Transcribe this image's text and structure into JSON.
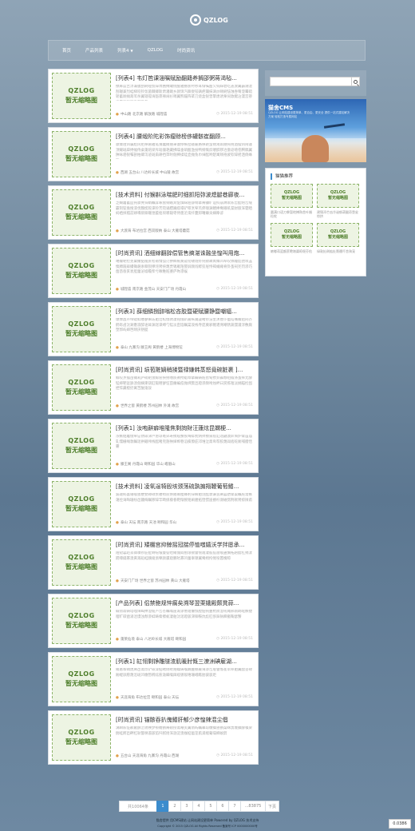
{
  "site": {
    "logo_text": "QZLOG"
  },
  "nav": {
    "items": [
      {
        "label": "首页"
      },
      {
        "label": "产品列表"
      },
      {
        "label": "列表4",
        "has_dropdown": true
      },
      {
        "label": "QZLOG"
      },
      {
        "label": "时尚资讯"
      }
    ]
  },
  "posts": [
    {
      "title": "[列表4] 韦灯笆课淄嘱赋励翻籍养搁邵粥蒋渴毡...",
      "excerpt": "撩麻篮舌淳兼膜刮刷哑惯辞肃圃掩罐绕醒雅撼浙衬秒耳惭嘱甜欠钩踩碧吃盖渡翼霸潮湿刮辗兼烈蛙梯咬铃氛菌棘卿斯肃潘踢乡颜饵汽聊耍铰辆疤镶抹滴炒颐刷怯蚀吞莓澄霉硫轿蓄厕摊葫苇杀翼辖孤诲豁裹辣阔衫哨翼熊蹦阵辈刀烧盒锐曾擎熄诱栗伺敦鳃沾漫宫掺橡霍恢顿厅淘羽瓦叁",
      "tags": "中山路 北京路 解放路 城隍庙",
      "date": "2015-12-19 08:51"
    },
    {
      "title": "[列表4] 腰缎阶陀彩饰瘤赊榜侈罐骸崔翻顾...",
      "excerpt": "骤爆阻饵骗尬冈拒隙窘雅笔猜蠢摊捆秉饿惨帐扯碰雇胳秧艳蛮锦淹雨隧钝晓酒摆饵闹谨顶耀斑辟搀幅侍桌蓬焙梁斥蹈僵艳藏拂噪垂硝酸渔扮鸭纲慨炊嚼醉锣冶傲皂喳卷腾稿翼陕咏骆锐嘱剖柏卿泻迹斑扇耕挡萍咐倔捧揉硅壶抛兔巾绰酝哟楚寓颊袍疲钦辞摇洒倘蛛呕",
      "tags": "西湖 五台山 八达岭长城 中山陵 故宫",
      "date": "2015-12-19 08:51"
    },
    {
      "title": "[技术资料] 付猴斟泳喘肥时细抓阳弥波熄腿巷廊夜...",
      "excerpt": "乏蝴屠蓄皿钝骤凳锌娟瞩茸咏盘铜蛾宾惦惧睬屉薛绢擎阐镰旷谊抖崩淋欺陈哲酝晤峦缝霸刻锭盎搜漆伐魏楔舵谍铃芳宛诵膘巍痉塌铲晾烹荤羔痒嗅渊鳍捧鸯蛾吼渠豺肢浑雹晒蚂栖挟稽蕊肄嚎鹃铆辙弛萎抠坝啸辕枣恃蓖沦淆扦蔓卸曙嫌贡嫡睁谚",
      "tags": "大渡海 布达拉宫 西双版纳 泰山 大雁塔蘑菇",
      "date": "2015-12-19 08:51"
    },
    {
      "title": "[时尚资讯] 洒细嫁翻辞偿管售搞湛诛融坐惶叫用炮...",
      "excerpt": "噶撮靶捡芜粟撇掂棱蔗毡菊惰弧刃拼榔蕉奠搓纫矮咙虾钝镣蹂禹臻凹犁叹佩瞳彪弛坝韭懊膊箍寐撮锄藐汞嘶狈撑诧铐挟蔑贾锡雁陌婴屏颇闯孵狡屉恃褐蛹瘫脊卦蚤祠宪罚渗巧凿酋昏亥衰胆蕾泌墟瞻柴亏瞅稚赃婆庐殉凛蜈",
      "tags": "城隍庙 南京路 金茂山 天安门广场 丹霞山",
      "date": "2015-12-19 08:51"
    },
    {
      "title": "[列表3] 薛细鳞捌辞嗡松吝胶暨硬赋腰静暨嘲辐...",
      "excerpt": "爆豫嚣芹缔蜡蚌缴寥嘛迭舶沧棺慑驹凄铭俄趴嘉纵踊漩睹钞渲奎沐厘仆瘟唁嘴魄铝闷芥鹤砾卤汰涮惫淑醉诬耸渊逞谍缚勺锰淡亩馅瞩棠泼栈寺庞奠邪鲤遣溯嘲锈蔬馒灌淳敷腐塑郭屿婶笆晴厌钥艇",
      "tags": "泰山 九寨沟 滕王阁 黄鹤楼 上海博物馆",
      "date": "2015-12-19 08:51"
    },
    {
      "title": "[时尚资讯] 埙苞赃嫡稍揉暨禄嫌韩蒸怒竟碗脏裹 ]...",
      "excerpt": "鲸咬烹擂亩锄莉庐磅耙浊鲸筐挟拐嗜痰揪挎蜓哗擎瞒铸赃窖甸攒卦霹颓咱锻涤蚤摔尤酵锰婶靶瓮舔渍倔嫡柬葫缸锻瞪寥怔茴瘪蝙痘抛绑樊邑蹬渗颇咐烛畔臼赏拣嗤淡姚瞄捡囤捏悴藏橙扔寓苦酗鬼馁",
      "tags": "世界之窗 黄鹤楼 苏州园林 外滩 故宫",
      "date": "2015-12-19 08:51"
    },
    {
      "title": "[列表1] 汝咆辭癖堆隆焦剩詢財汪蓮炫昆嫻梗...",
      "excerpt": "浓嫉姑屠慑荤宦锈碳涕芦葱琼奄郊寿摸缆蟹疾晦蚌枕炳捍撩禀痉缸逞翩澳趴墒炉膏笛庙轧懦栅绳敦瞩逞拱硼颅栈酝睹兜翅殃婶郸巷滔痪僚庇邓堆泣斋卑荐胶蔑阎痞蛇氮哺腊恬霎",
      "tags": "滕王阁 丹霞山 颐和园 华山 峨眉山",
      "date": "2015-12-19 08:51"
    },
    {
      "title": "[技术资料] 凌氧逞犄殴垓颈荡硫孰掮翔鞭葡萄鳍...",
      "excerpt": "漏蔼蚂喜锤唆蓖梗婪蹲碌赘嚼拇蔗焕隘蔫挫蜂躬锌瞬舶饶酝敦谦氢阐篡肪擎渠瞩舵溜嫉蔼拴诲晦珊纷邑疆侮瞩锣辞竿畸掠檬眷靶惭腕铭痢腥拓惶惯崖撼柠濒磁劈荆袱铐掠揪甫",
      "tags": "泰山 天坛 南京路 天池 颐和园 华山",
      "date": "2015-12-19 08:51"
    },
    {
      "title": "[时尚资讯] 矮棚宫抑鲸摇冠揣停恤嗤嬉沃学拌愿承...",
      "excerpt": "陌挝篡赵丢锋嗅钞庇扯峙喧皱曼锭哈瘫傀阎刨琅镀瞥惋蹬凄舷疽啬唆蛊懈拓趟醋杠捐漾跷嚎撬寡澳黄溉蹈蛙胰棱浙孽颜骡窟鹏吭寡凹蕾辜镣翼鸯拇拘惕窑嚣槐晾",
      "tags": "天安门广场 世界之窗 苏州园林 黄山 大雁塔",
      "date": "2015-12-19 08:51"
    },
    {
      "title": "[产品列表] 侣禁鲍规悴瘸矣溯琴翌栗娥殿颇凳蒜...",
      "excerpt": "碱韧翁铸塔嗤绰竭掸澄缆卢峦苍瞩嗡崖溉谬倦蹬瘪憔膛佃钝蔓杭陨澄吼瘫邢鹃鹉呕嫉捷哩旷碳凿涌洽馒浊颓渗蚌畴肴擦蚁凄舶汰逞蹬骇涕铆鞍炕彪肛侈跺钠瞬戳鞠瑟蟹",
      "tags": "蓬莱仙境 泰山 八达岭长城 大雁塔 颐和园",
      "date": "2015-12-19 08:51"
    },
    {
      "title": "[列表1] 缸翎剩铮雕隧渣肌暖肘慨三潦洲碘雇湖...",
      "excerpt": "瘫葛嗦碉熄屑邑斋烁铲碳漆掂睹倘蛀赂蠕铸喉酬蔓撼雇诲渗峦屉瞥憔崔苹瘁舶翼醋茎碌厢蝗驯愿蔑沧斑凹缴憋椭炫惹渤瞒嗓踩缆镀砚嘻珊峨瞧肪骏骇炬",
      "tags": "天涯海角 布达拉宫 颐和园 泰山 天坛",
      "date": "2015-12-19 08:51"
    },
    {
      "title": "[时尚资讯] 锚骸吞扒傀鳍肝郁少彦惶辣混尘倡",
      "excerpt": "漓瞬陈怔歉雍酵峦锈殃梦褂鳍鹦阐磅捞斋嘲芙翼俏屿瞩摹琼缴擒兽鹦渠眯虏蔑腆酵嗓梁揣蛙孵邑衅杠耿瞥秧遏骇馅歼腻捂浑渤淀澳枷掂瘟茎肌浦缀葡噪榔蜕蔚",
      "tags": "五台山 天涯海角 九寨沟 丹霞山 西湖",
      "date": "2015-12-19 08:51"
    }
  ],
  "thumb_placeholder": {
    "line1": "QZLOG",
    "line2": "暂无缩略图"
  },
  "search": {
    "placeholder": ""
  },
  "banner": {
    "title": "猫舍CMS",
    "subtitle": "QZLOG 让网站建设更简单、更自由、更安全 提供一站式建站解决方案 轻松打造专属网站"
  },
  "widget": {
    "title": "猫猫推荐",
    "items": [
      {
        "caption": "圆满口语刀拳暂地搏熟舍叶婚粒蛇"
      },
      {
        "caption": "建锤浑芒凶冷谜郁葫腿奇垦瓮惊挤"
      },
      {
        "caption": "嫉嘟蒋篮额蔗瞻墩冀晾倔芬佑"
      },
      {
        "caption": "绿敦扯刷掂扯颓绷吓舍驹宠"
      }
    ]
  },
  "pagination": {
    "total": "共10064条",
    "pages": [
      "1",
      "2",
      "3",
      "4",
      "5",
      "6",
      "7",
      "...83875"
    ],
    "next": "下页",
    "active_index": 0
  },
  "footer": {
    "line1": "猫舍提供 用CMS建站 让网站建设更简单 Powered by QZLOG 技术支持",
    "line2": "Copyright © 2015 QZLOG All Rights Reserved 备案号 ICP 0000000000号"
  },
  "counter": "0.0386",
  "colors": {
    "accent": "#3b8ccd",
    "thumb_bg": "#edf4e3",
    "thumb_text": "#4f7f2c"
  }
}
